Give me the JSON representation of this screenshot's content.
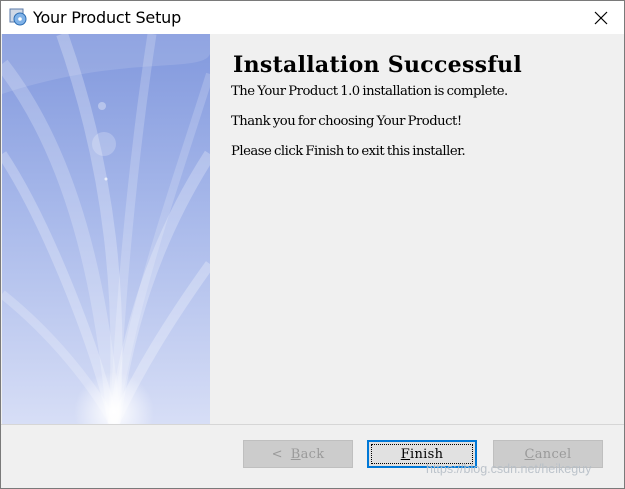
{
  "window": {
    "title": "Your Product Setup",
    "close_icon": "close-icon"
  },
  "content": {
    "heading": "Installation Successful",
    "line1": "The Your Product 1.0 installation is complete.",
    "line2": "Thank you for choosing Your Product!",
    "line3": "Please click Finish to exit this installer."
  },
  "buttons": {
    "back": {
      "icon": "<",
      "mnemonic": "B",
      "rest": "ack",
      "enabled": false
    },
    "finish": {
      "mnemonic": "F",
      "rest": "inish",
      "enabled": true
    },
    "cancel": {
      "mnemonic": "C",
      "rest": "ancel",
      "enabled": false
    }
  },
  "watermark": "https://blog.csdn.net/heikeguy",
  "colors": {
    "focus_border": "#0078d7",
    "panel_blue": "#8ea4e0"
  }
}
